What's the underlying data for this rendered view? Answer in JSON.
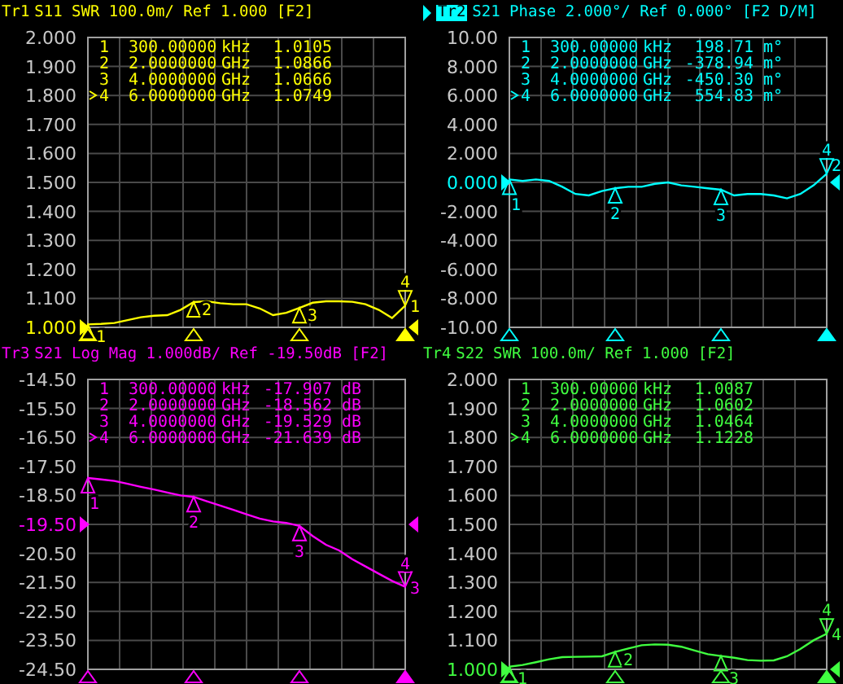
{
  "traces": [
    {
      "name": "Tr1",
      "selected": false,
      "color": "#ffff00",
      "title": "S11 SWR 100.0m/ Ref 1.000 [F2]",
      "trace_number": "1",
      "reference_at_bottom": true,
      "markers": [
        {
          "label": "1",
          "tag": "1",
          "active": false,
          "frequency": "300.00000",
          "unit": "kHz",
          "value": "1.0105"
        },
        {
          "label": "2",
          "tag": "2",
          "active": false,
          "frequency": "2.0000000",
          "unit": "GHz",
          "value": "1.0866"
        },
        {
          "label": "3",
          "tag": "3",
          "active": false,
          "frequency": "4.0000000",
          "unit": "GHz",
          "value": "1.0666"
        },
        {
          "label": "4",
          "tag": "4",
          "active": true,
          "frequency": "6.0000000",
          "unit": "GHz",
          "value": "1.0749"
        }
      ],
      "chart_data": {
        "type": "line",
        "grid": true,
        "categories": [
          null,
          null,
          null,
          null,
          null,
          null,
          null,
          null,
          null,
          null,
          null,
          null,
          null,
          null,
          null,
          null,
          null,
          null,
          null,
          null,
          null,
          null,
          null,
          null,
          null
        ],
        "ylim": [
          1.0,
          2.0
        ],
        "yticks": [
          {
            "value": 2.0,
            "label": "2.000"
          },
          {
            "value": 1.9,
            "label": "1.900"
          },
          {
            "value": 1.8,
            "label": "1.800"
          },
          {
            "value": 1.7,
            "label": "1.700"
          },
          {
            "value": 1.6,
            "label": "1.600"
          },
          {
            "value": 1.5,
            "label": "1.500"
          },
          {
            "value": 1.4,
            "label": "1.400"
          },
          {
            "value": 1.3,
            "label": "1.300"
          },
          {
            "value": 1.2,
            "label": "1.200"
          },
          {
            "value": 1.1,
            "label": "1.100"
          },
          {
            "value": 1.0,
            "label": "1.000"
          }
        ],
        "series": [
          {
            "color": "#ffff00",
            "values": [
              1.01,
              1.012,
              1.015,
              1.025,
              1.035,
              1.04,
              1.042,
              1.06,
              1.087,
              1.09,
              1.083,
              1.08,
              1.08,
              1.065,
              1.042,
              1.05,
              1.067,
              1.085,
              1.09,
              1.09,
              1.088,
              1.08,
              1.06,
              1.032,
              1.075
            ]
          }
        ]
      }
    },
    {
      "name": "Tr2",
      "selected": true,
      "color": "#00ffff",
      "title": "S21 Phase 2.000°/ Ref 0.000° [F2 D/M]",
      "trace_number": "2",
      "reference_at_bottom": false,
      "markers": [
        {
          "label": "1",
          "tag": "1",
          "active": false,
          "frequency": "300.00000",
          "unit": "kHz",
          "value": "198.71",
          "value_unit": "m°"
        },
        {
          "label": "2",
          "tag": "2",
          "active": false,
          "frequency": "2.0000000",
          "unit": "GHz",
          "value": "-378.94",
          "value_unit": "m°"
        },
        {
          "label": "3",
          "tag": "3",
          "active": false,
          "frequency": "4.0000000",
          "unit": "GHz",
          "value": "-450.30",
          "value_unit": "m°"
        },
        {
          "label": "4",
          "tag": "4",
          "active": true,
          "frequency": "6.0000000",
          "unit": "GHz",
          "value": "554.83",
          "value_unit": "m°"
        }
      ],
      "chart_data": {
        "type": "line",
        "grid": true,
        "categories": [
          null,
          null,
          null,
          null,
          null,
          null,
          null,
          null,
          null,
          null,
          null,
          null,
          null,
          null,
          null,
          null,
          null,
          null,
          null,
          null,
          null,
          null,
          null,
          null,
          null
        ],
        "ylim": [
          -10,
          10
        ],
        "yticks": [
          {
            "value": 10,
            "label": "10.00"
          },
          {
            "value": 8,
            "label": "8.000"
          },
          {
            "value": 6,
            "label": "6.000"
          },
          {
            "value": 4,
            "label": "4.000"
          },
          {
            "value": 2,
            "label": "2.000"
          },
          {
            "value": 0,
            "label": "0.000"
          },
          {
            "value": -2,
            "label": "-2.000"
          },
          {
            "value": -4,
            "label": "-4.000"
          },
          {
            "value": -6,
            "label": "-6.000"
          },
          {
            "value": -8,
            "label": "-8.000"
          },
          {
            "value": -10,
            "label": "-10.00"
          }
        ],
        "series": [
          {
            "color": "#00ffff",
            "values": [
              0.2,
              0.1,
              0.2,
              0.1,
              -0.3,
              -0.8,
              -0.9,
              -0.6,
              -0.4,
              -0.3,
              -0.3,
              -0.1,
              0.0,
              -0.2,
              -0.3,
              -0.4,
              -0.5,
              -0.9,
              -0.8,
              -0.8,
              -0.9,
              -1.1,
              -0.8,
              -0.2,
              0.6
            ]
          }
        ]
      }
    },
    {
      "name": "Tr3",
      "selected": false,
      "color": "#ff00ff",
      "title": "S21 Log Mag 1.000dB/ Ref -19.50dB [F2]",
      "trace_number": "3",
      "reference_at_bottom": false,
      "markers": [
        {
          "label": "1",
          "tag": "1",
          "active": false,
          "frequency": "300.00000",
          "unit": "kHz",
          "value": "-17.907",
          "value_unit": "dB"
        },
        {
          "label": "2",
          "tag": "2",
          "active": false,
          "frequency": "2.0000000",
          "unit": "GHz",
          "value": "-18.562",
          "value_unit": "dB"
        },
        {
          "label": "3",
          "tag": "3",
          "active": false,
          "frequency": "4.0000000",
          "unit": "GHz",
          "value": "-19.529",
          "value_unit": "dB"
        },
        {
          "label": "4",
          "tag": "4",
          "active": true,
          "frequency": "6.0000000",
          "unit": "GHz",
          "value": "-21.639",
          "value_unit": "dB"
        }
      ],
      "chart_data": {
        "type": "line",
        "grid": true,
        "categories": [
          null,
          null,
          null,
          null,
          null,
          null,
          null,
          null,
          null,
          null,
          null,
          null,
          null,
          null,
          null,
          null,
          null,
          null,
          null,
          null,
          null,
          null,
          null,
          null,
          null
        ],
        "ylim": [
          -24.5,
          -14.5
        ],
        "yticks": [
          {
            "value": -14.5,
            "label": "-14.50"
          },
          {
            "value": -15.5,
            "label": "-15.50"
          },
          {
            "value": -16.5,
            "label": "-16.50"
          },
          {
            "value": -17.5,
            "label": "-17.50"
          },
          {
            "value": -18.5,
            "label": "-18.50"
          },
          {
            "value": -19.5,
            "label": "-19.50"
          },
          {
            "value": -20.5,
            "label": "-20.50"
          },
          {
            "value": -21.5,
            "label": "-21.50"
          },
          {
            "value": -22.5,
            "label": "-22.50"
          },
          {
            "value": -23.5,
            "label": "-23.50"
          },
          {
            "value": -24.5,
            "label": "-24.50"
          }
        ],
        "series": [
          {
            "color": "#ff00ff",
            "values": [
              -17.9,
              -17.95,
              -18.0,
              -18.1,
              -18.2,
              -18.3,
              -18.4,
              -18.5,
              -18.55,
              -18.7,
              -18.85,
              -19.0,
              -19.15,
              -19.3,
              -19.4,
              -19.45,
              -19.55,
              -19.9,
              -20.2,
              -20.4,
              -20.7,
              -20.95,
              -21.2,
              -21.45,
              -21.65
            ]
          }
        ]
      }
    },
    {
      "name": "Tr4",
      "selected": false,
      "color": "#40ff40",
      "title": "S22 SWR 100.0m/ Ref 1.000 [F2]",
      "trace_number": "4",
      "reference_at_bottom": true,
      "markers": [
        {
          "label": "1",
          "tag": "1",
          "active": false,
          "frequency": "300.00000",
          "unit": "kHz",
          "value": "1.0087"
        },
        {
          "label": "2",
          "tag": "2",
          "active": false,
          "frequency": "2.0000000",
          "unit": "GHz",
          "value": "1.0602"
        },
        {
          "label": "3",
          "tag": "3",
          "active": false,
          "frequency": "4.0000000",
          "unit": "GHz",
          "value": "1.0464"
        },
        {
          "label": "4",
          "tag": "4",
          "active": true,
          "frequency": "6.0000000",
          "unit": "GHz",
          "value": "1.1228"
        }
      ],
      "chart_data": {
        "type": "line",
        "grid": true,
        "categories": [
          null,
          null,
          null,
          null,
          null,
          null,
          null,
          null,
          null,
          null,
          null,
          null,
          null,
          null,
          null,
          null,
          null,
          null,
          null,
          null,
          null,
          null,
          null,
          null,
          null
        ],
        "ylim": [
          1.0,
          2.0
        ],
        "yticks": [
          {
            "value": 2.0,
            "label": "2.000"
          },
          {
            "value": 1.9,
            "label": "1.900"
          },
          {
            "value": 1.8,
            "label": "1.800"
          },
          {
            "value": 1.7,
            "label": "1.700"
          },
          {
            "value": 1.6,
            "label": "1.600"
          },
          {
            "value": 1.5,
            "label": "1.500"
          },
          {
            "value": 1.4,
            "label": "1.400"
          },
          {
            "value": 1.3,
            "label": "1.300"
          },
          {
            "value": 1.2,
            "label": "1.200"
          },
          {
            "value": 1.1,
            "label": "1.100"
          },
          {
            "value": 1.0,
            "label": "1.000"
          }
        ],
        "series": [
          {
            "color": "#40ff40",
            "values": [
              1.009,
              1.015,
              1.025,
              1.035,
              1.042,
              1.043,
              1.044,
              1.045,
              1.06,
              1.072,
              1.083,
              1.086,
              1.085,
              1.078,
              1.065,
              1.052,
              1.046,
              1.04,
              1.032,
              1.03,
              1.031,
              1.045,
              1.07,
              1.1,
              1.123
            ]
          }
        ]
      }
    }
  ]
}
